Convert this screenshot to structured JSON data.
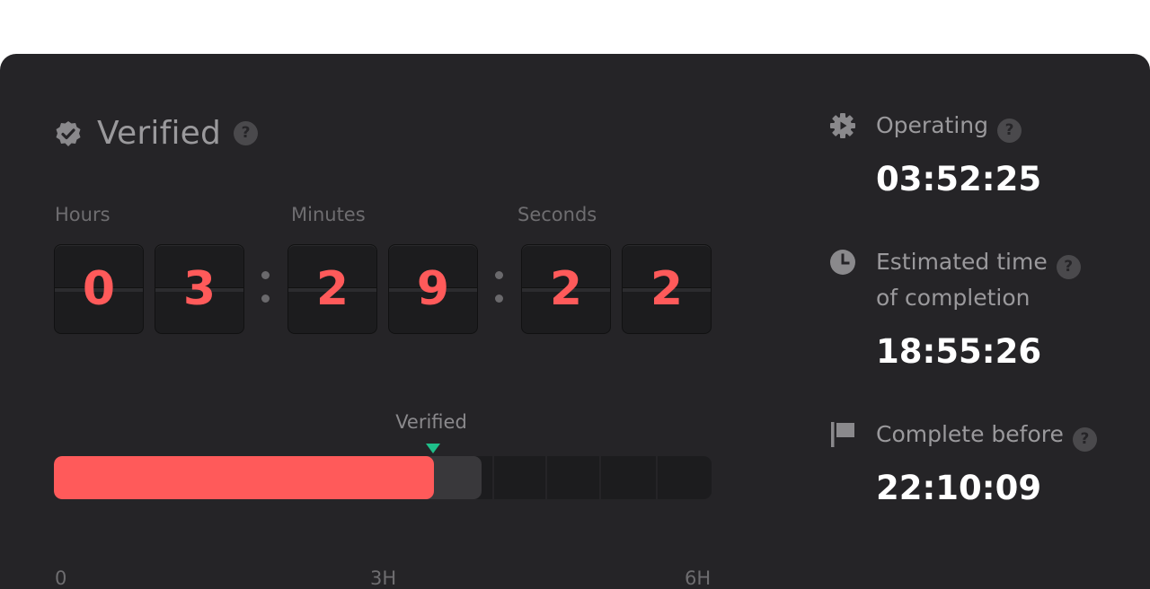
{
  "status": {
    "title": "Verified",
    "help": "?"
  },
  "countdown": {
    "hours_label": "Hours",
    "minutes_label": "Minutes",
    "seconds_label": "Seconds",
    "digits": [
      "0",
      "3",
      "2",
      "9",
      "2",
      "2"
    ]
  },
  "progress": {
    "marker_label": "Verified",
    "filled_fraction": 0.578,
    "pending_fraction": 0.65,
    "ticks": [
      "0",
      "3H",
      "6H"
    ],
    "colors": {
      "fill": "#ff5a5a",
      "marker": "#1fbf8a",
      "pending": "#39383b"
    }
  },
  "info": {
    "operating": {
      "label": "Operating",
      "value": "03:52:25",
      "icon": "gear-play-icon"
    },
    "estimated": {
      "label_line1": "Estimated time",
      "label_line2": "of completion",
      "value": "18:55:26",
      "icon": "clock-icon"
    },
    "deadline": {
      "label": "Complete before",
      "value": "22:10:09",
      "icon": "flag-icon"
    },
    "help": "?"
  }
}
